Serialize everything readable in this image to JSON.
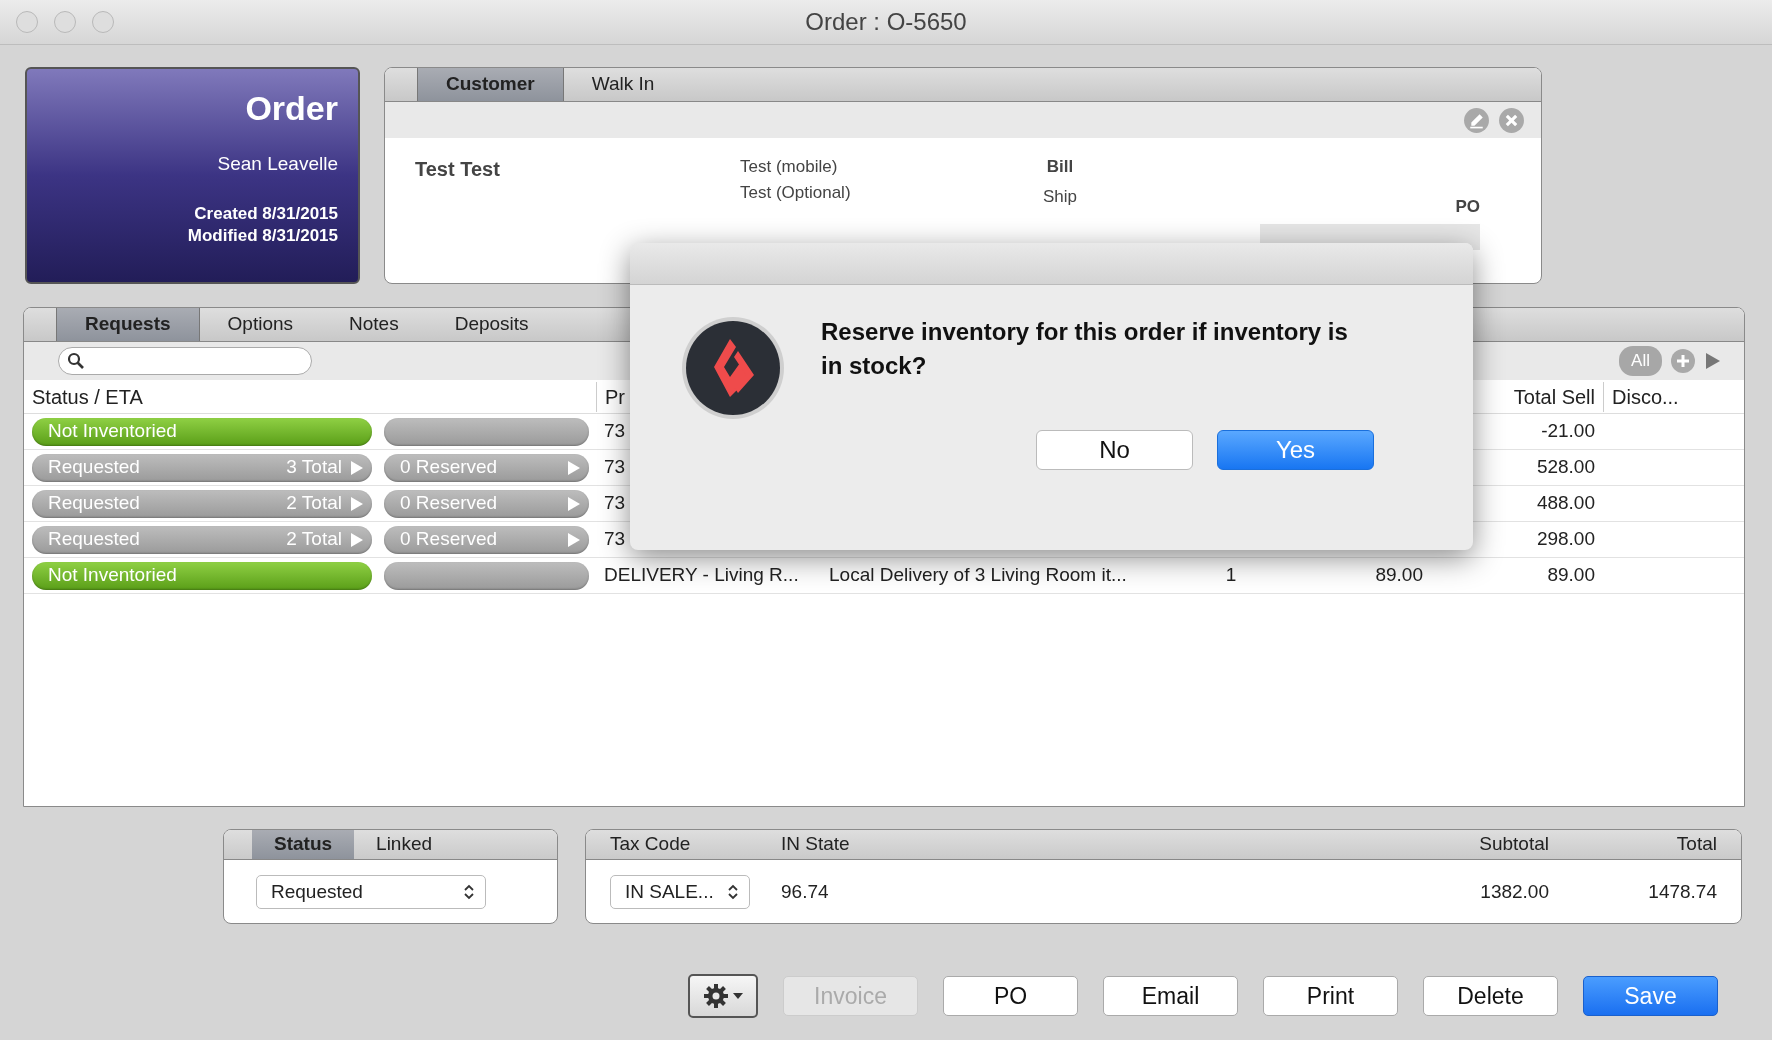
{
  "window": {
    "title": "Order : O-5650"
  },
  "order_card": {
    "heading": "Order",
    "salesperson": "Sean Leavelle",
    "created": "Created 8/31/2015",
    "modified": "Modified 8/31/2015"
  },
  "customer_panel": {
    "tabs": [
      {
        "label": "Customer",
        "selected": true
      },
      {
        "label": "Walk In",
        "selected": false
      }
    ],
    "name": "Test Test",
    "phones": [
      "Test (mobile)",
      "Test (Optional)"
    ],
    "bill_label": "Bill",
    "ship_label": "Ship",
    "po_label": "PO"
  },
  "requests_panel": {
    "tabs": [
      {
        "label": "Requests",
        "selected": true
      },
      {
        "label": "Options",
        "selected": false
      },
      {
        "label": "Notes",
        "selected": false
      },
      {
        "label": "Deposits",
        "selected": false
      }
    ],
    "filter": "All",
    "table": {
      "columns": [
        "Status / ETA",
        "Pr",
        "Total Sell",
        "Disco..."
      ],
      "rows": [
        {
          "kind": "not_inventoried",
          "status": "Not Inventoried",
          "product": "73",
          "total_sell": "-21.00"
        },
        {
          "kind": "requested",
          "status": "Requested",
          "total": "3 Total",
          "reserved": "0 Reserved",
          "product": "73",
          "total_sell": "528.00"
        },
        {
          "kind": "requested",
          "status": "Requested",
          "total": "2 Total",
          "reserved": "0 Reserved",
          "product": "73",
          "total_sell": "488.00"
        },
        {
          "kind": "requested",
          "status": "Requested",
          "total": "2 Total",
          "reserved": "0 Reserved",
          "product": "73",
          "total_sell": "298.00"
        },
        {
          "kind": "not_inventoried",
          "status": "Not Inventoried",
          "product": "DELIVERY - Living R...",
          "description": "Local Delivery of 3 Living Room it...",
          "qty": "1",
          "price": "89.00",
          "total_sell": "89.00"
        }
      ]
    }
  },
  "dialog": {
    "message": "Reserve inventory for this order if inventory is in stock?",
    "buttons": [
      {
        "label": "No",
        "kind": "default"
      },
      {
        "label": "Yes",
        "kind": "primary"
      }
    ]
  },
  "status_panel": {
    "tabs": [
      {
        "label": "Status",
        "selected": true
      },
      {
        "label": "Linked",
        "selected": false
      }
    ],
    "value": "Requested"
  },
  "totals_panel": {
    "columns": [
      "Tax Code",
      "IN State",
      "Subtotal",
      "Total"
    ],
    "tax_code": "IN SALE...",
    "tax": "96.74",
    "subtotal": "1382.00",
    "total": "1478.74"
  },
  "toolbar": {
    "buttons": [
      {
        "label": "Invoice",
        "kind": "default",
        "disabled": true
      },
      {
        "label": "PO",
        "kind": "default",
        "disabled": false
      },
      {
        "label": "Email",
        "kind": "default",
        "disabled": false
      },
      {
        "label": "Print",
        "kind": "default",
        "disabled": false
      },
      {
        "label": "Delete",
        "kind": "default",
        "disabled": false
      },
      {
        "label": "Save",
        "kind": "primary",
        "disabled": false
      }
    ]
  }
}
